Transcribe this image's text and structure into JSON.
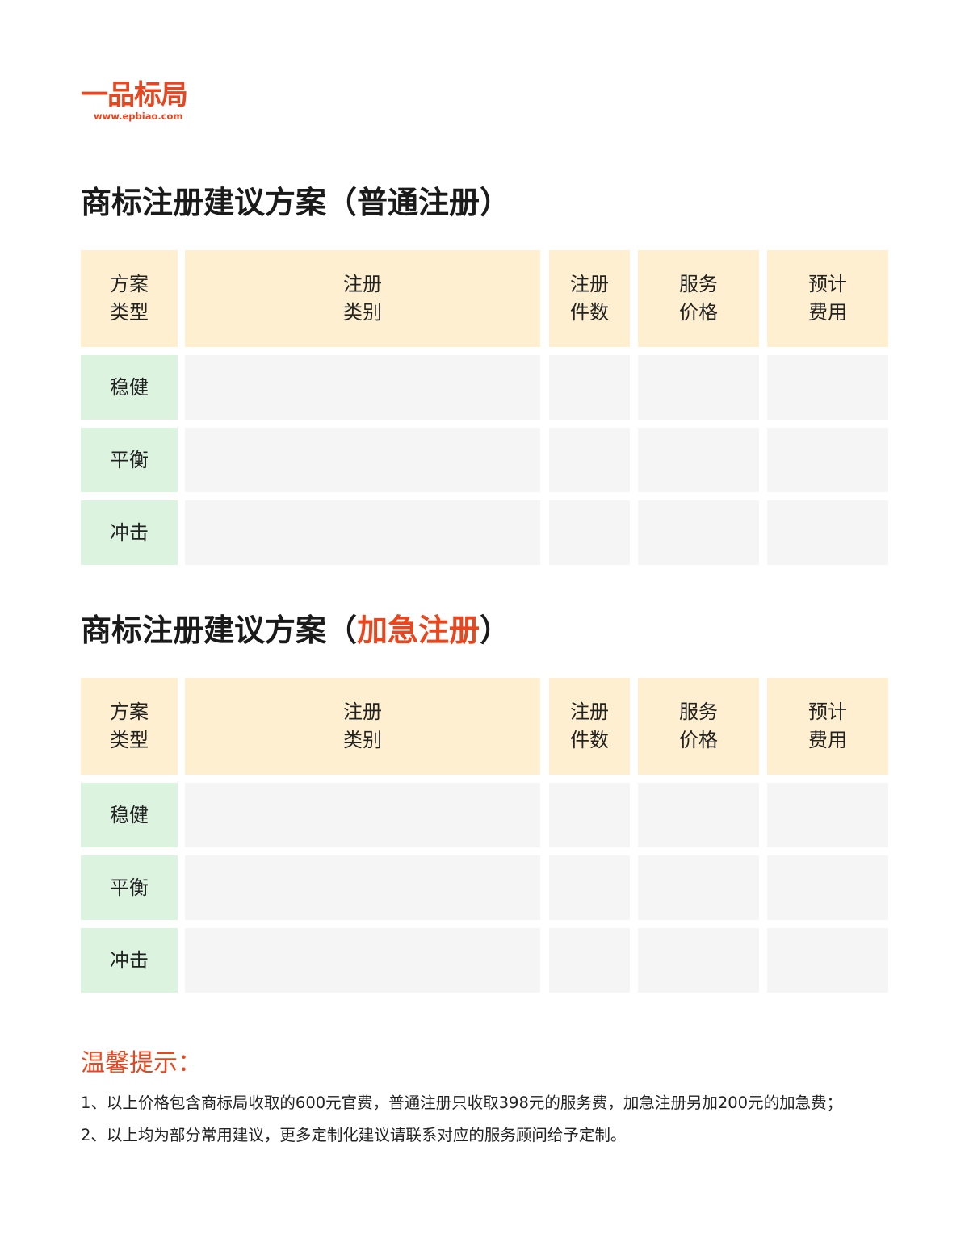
{
  "logo": {
    "name": "一品标局",
    "url": "www.epbiao.com"
  },
  "sections": [
    {
      "title_prefix": "商标注册建议方案（",
      "title_highlight": "普通注册",
      "title_suffix": "）",
      "headers": [
        [
          "方案",
          "类型"
        ],
        [
          "注册",
          "类别"
        ],
        [
          "注册",
          "件数"
        ],
        [
          "服务",
          "价格"
        ],
        [
          "预计",
          "费用"
        ]
      ],
      "rows": [
        "稳健",
        "平衡",
        "冲击"
      ]
    },
    {
      "title_prefix": "商标注册建议方案（",
      "title_highlight": "加急注册",
      "title_suffix": "）",
      "headers": [
        [
          "方案",
          "类型"
        ],
        [
          "注册",
          "类别"
        ],
        [
          "注册",
          "件数"
        ],
        [
          "服务",
          "价格"
        ],
        [
          "预计",
          "费用"
        ]
      ],
      "rows": [
        "稳健",
        "平衡",
        "冲击"
      ]
    }
  ],
  "tips": {
    "title": "温馨提示：",
    "items": [
      "1、以上价格包含商标局收取的600元官费，普通注册只收取398元的服务费，加急注册另加200元的加急费；",
      "2、以上均为部分常用建议，更多定制化建议请联系对应的服务顾问给予定制。"
    ]
  },
  "colors": {
    "accent": "#e8461e",
    "header_bg": "#fdefcf",
    "row_label_bg": "#dcf3e0",
    "cell_bg": "#f5f5f5"
  }
}
